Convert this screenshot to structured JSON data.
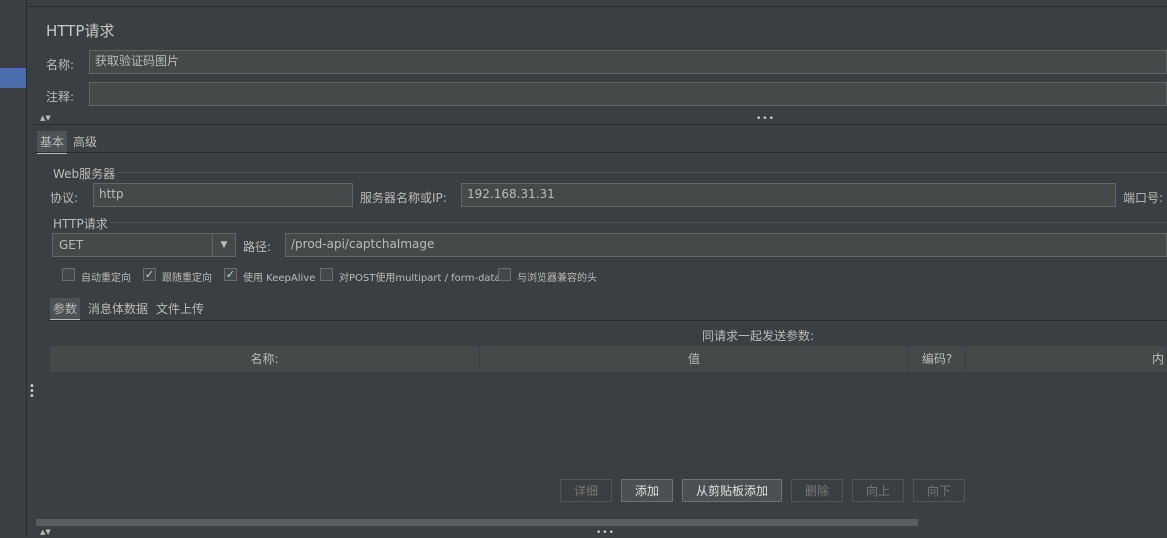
{
  "panel": {
    "title": "HTTP请求",
    "name_label": "名称:",
    "name_value": "获取验证码图片",
    "comment_label": "注释:",
    "comment_value": ""
  },
  "tabs": {
    "basic": "基本",
    "advanced": "高级"
  },
  "web_server": {
    "group_title": "Web服务器",
    "protocol_label": "协议:",
    "protocol_value": "http",
    "server_label": "服务器名称或IP:",
    "server_value": "192.168.31.31",
    "port_label": "端口号:"
  },
  "http_request": {
    "group_title": "HTTP请求",
    "method": "GET",
    "path_label": "路径:",
    "path_value": "/prod-api/captchaImage"
  },
  "options": [
    {
      "label": "自动重定向",
      "checked": false
    },
    {
      "label": "跟随重定向",
      "checked": true
    },
    {
      "label": "使用 KeepAlive",
      "checked": true
    },
    {
      "label": "对POST使用multipart / form-data",
      "checked": false
    },
    {
      "label": "与浏览器兼容的头",
      "checked": false
    }
  ],
  "sub_tabs": {
    "params": "参数",
    "body": "消息体数据",
    "files": "文件上传"
  },
  "params_table": {
    "caption": "同请求一起发送参数:",
    "columns": [
      "名称:",
      "值",
      "编码?",
      "内"
    ]
  },
  "buttons": {
    "detail": "详细",
    "add": "添加",
    "add_from_clipboard": "从剪贴板添加",
    "delete": "删除",
    "up": "向上",
    "down": "向下"
  },
  "icons": {
    "check": "check-icon",
    "dropdown": "triangle-down-icon",
    "collapse": "collapse-arrows-icon"
  }
}
